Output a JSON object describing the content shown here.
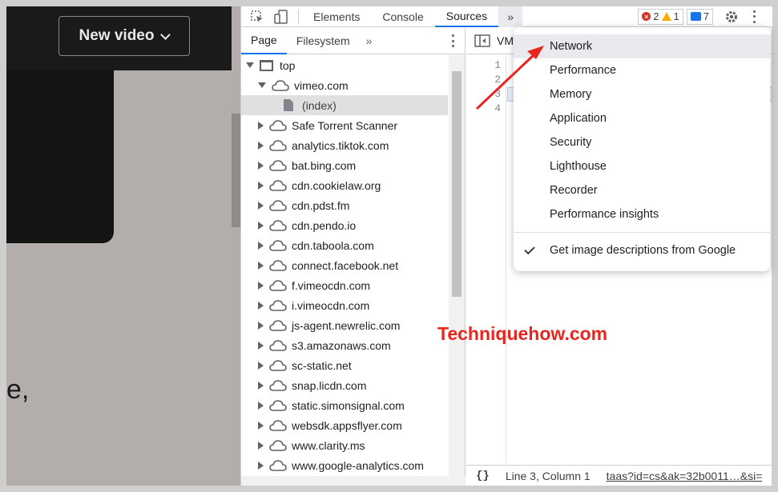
{
  "webpage": {
    "new_video_label": "New video",
    "text_fragment": "e,"
  },
  "devtools": {
    "tabs": [
      "Elements",
      "Console",
      "Sources"
    ],
    "more_tabs": "»",
    "errors": "2",
    "warnings": "1",
    "messages": "7",
    "nav_tabs": [
      "Page",
      "Filesystem"
    ],
    "nav_more": "»",
    "tree": {
      "top": "top",
      "domain": "vimeo.com",
      "index": "(index)",
      "items": [
        "Safe Torrent Scanner",
        "analytics.tiktok.com",
        "bat.bing.com",
        "cdn.cookielaw.org",
        "cdn.pdst.fm",
        "cdn.pendo.io",
        "cdn.taboola.com",
        "connect.facebook.net",
        "f.vimeocdn.com",
        "i.vimeocdn.com",
        "js-agent.newrelic.com",
        "s3.amazonaws.com",
        "sc-static.net",
        "snap.licdn.com",
        "static.simonsignal.com",
        "websdk.appsflyer.com",
        "www.clarity.ms",
        "www.google-analytics.com"
      ]
    },
    "editor_tab": "VM",
    "line_numbers": [
      "1",
      "2",
      "3",
      "4"
    ],
    "status": {
      "position": "Line 3, Column 1",
      "link": "taas?id=cs&ak=32b0011…&si="
    },
    "format_icon": "{}"
  },
  "menu": {
    "items": [
      "Network",
      "Performance",
      "Memory",
      "Application",
      "Security",
      "Lighthouse",
      "Recorder",
      "Performance insights"
    ],
    "checked_item": "Get image descriptions from Google"
  },
  "watermark": "Techniquehow.com",
  "colors": {
    "accent": "#1a73e8",
    "error": "#d93025",
    "warning": "#f9ab00",
    "annotation": "#e8261f"
  }
}
